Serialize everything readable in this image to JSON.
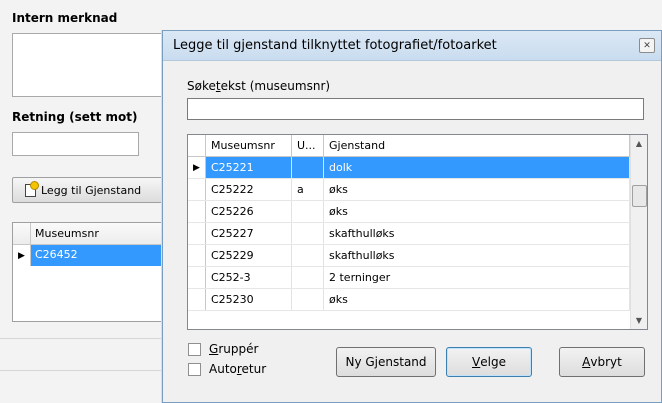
{
  "background_form": {
    "intern_merknad_label": "Intern merknad",
    "retning_label": "Retning (sett mot)",
    "add_button_label": "Legg til Gjenstand",
    "grid_header": "Museumsnr",
    "grid_rows": [
      "C26452"
    ]
  },
  "dialog": {
    "title": "Legge til gjenstand tilknyttet fotografiet/fotoarket",
    "search_label_pre": "Søke",
    "search_label_ul": "t",
    "search_label_post": "ekst (museumsnr)",
    "search_value": "",
    "columns": [
      "Museumsnr",
      "U...",
      "Gjenstand"
    ],
    "rows": [
      {
        "museumsnr": "C25221",
        "u": "",
        "gjenstand": "dolk",
        "selected": true
      },
      {
        "museumsnr": "C25222",
        "u": "a",
        "gjenstand": "øks"
      },
      {
        "museumsnr": "C25226",
        "u": "",
        "gjenstand": "øks"
      },
      {
        "museumsnr": "C25227",
        "u": "",
        "gjenstand": "skafthulløks"
      },
      {
        "museumsnr": "C25229",
        "u": "",
        "gjenstand": "skafthulløks"
      },
      {
        "museumsnr": "C252-3",
        "u": "",
        "gjenstand": "2 terninger"
      },
      {
        "museumsnr": "C25230",
        "u": "",
        "gjenstand": "øks"
      }
    ],
    "checkbox_grupper_ul": "G",
    "checkbox_grupper_rest": "ruppér",
    "checkbox_autoretur_pre": "Auto",
    "checkbox_autoretur_ul": "r",
    "checkbox_autoretur_post": "etur",
    "btn_ny_gjenstand": "Ny Gjenstand",
    "btn_velge_ul": "V",
    "btn_velge_rest": "elge",
    "btn_avbryt_ul": "A",
    "btn_avbryt_rest": "vbryt"
  },
  "colors": {
    "selection": "#3399ff",
    "title_bar": "#c9dcef"
  },
  "icons": {
    "close": "close-icon",
    "row_pointer": "row-pointer-icon",
    "new_doc": "new-document-icon"
  }
}
